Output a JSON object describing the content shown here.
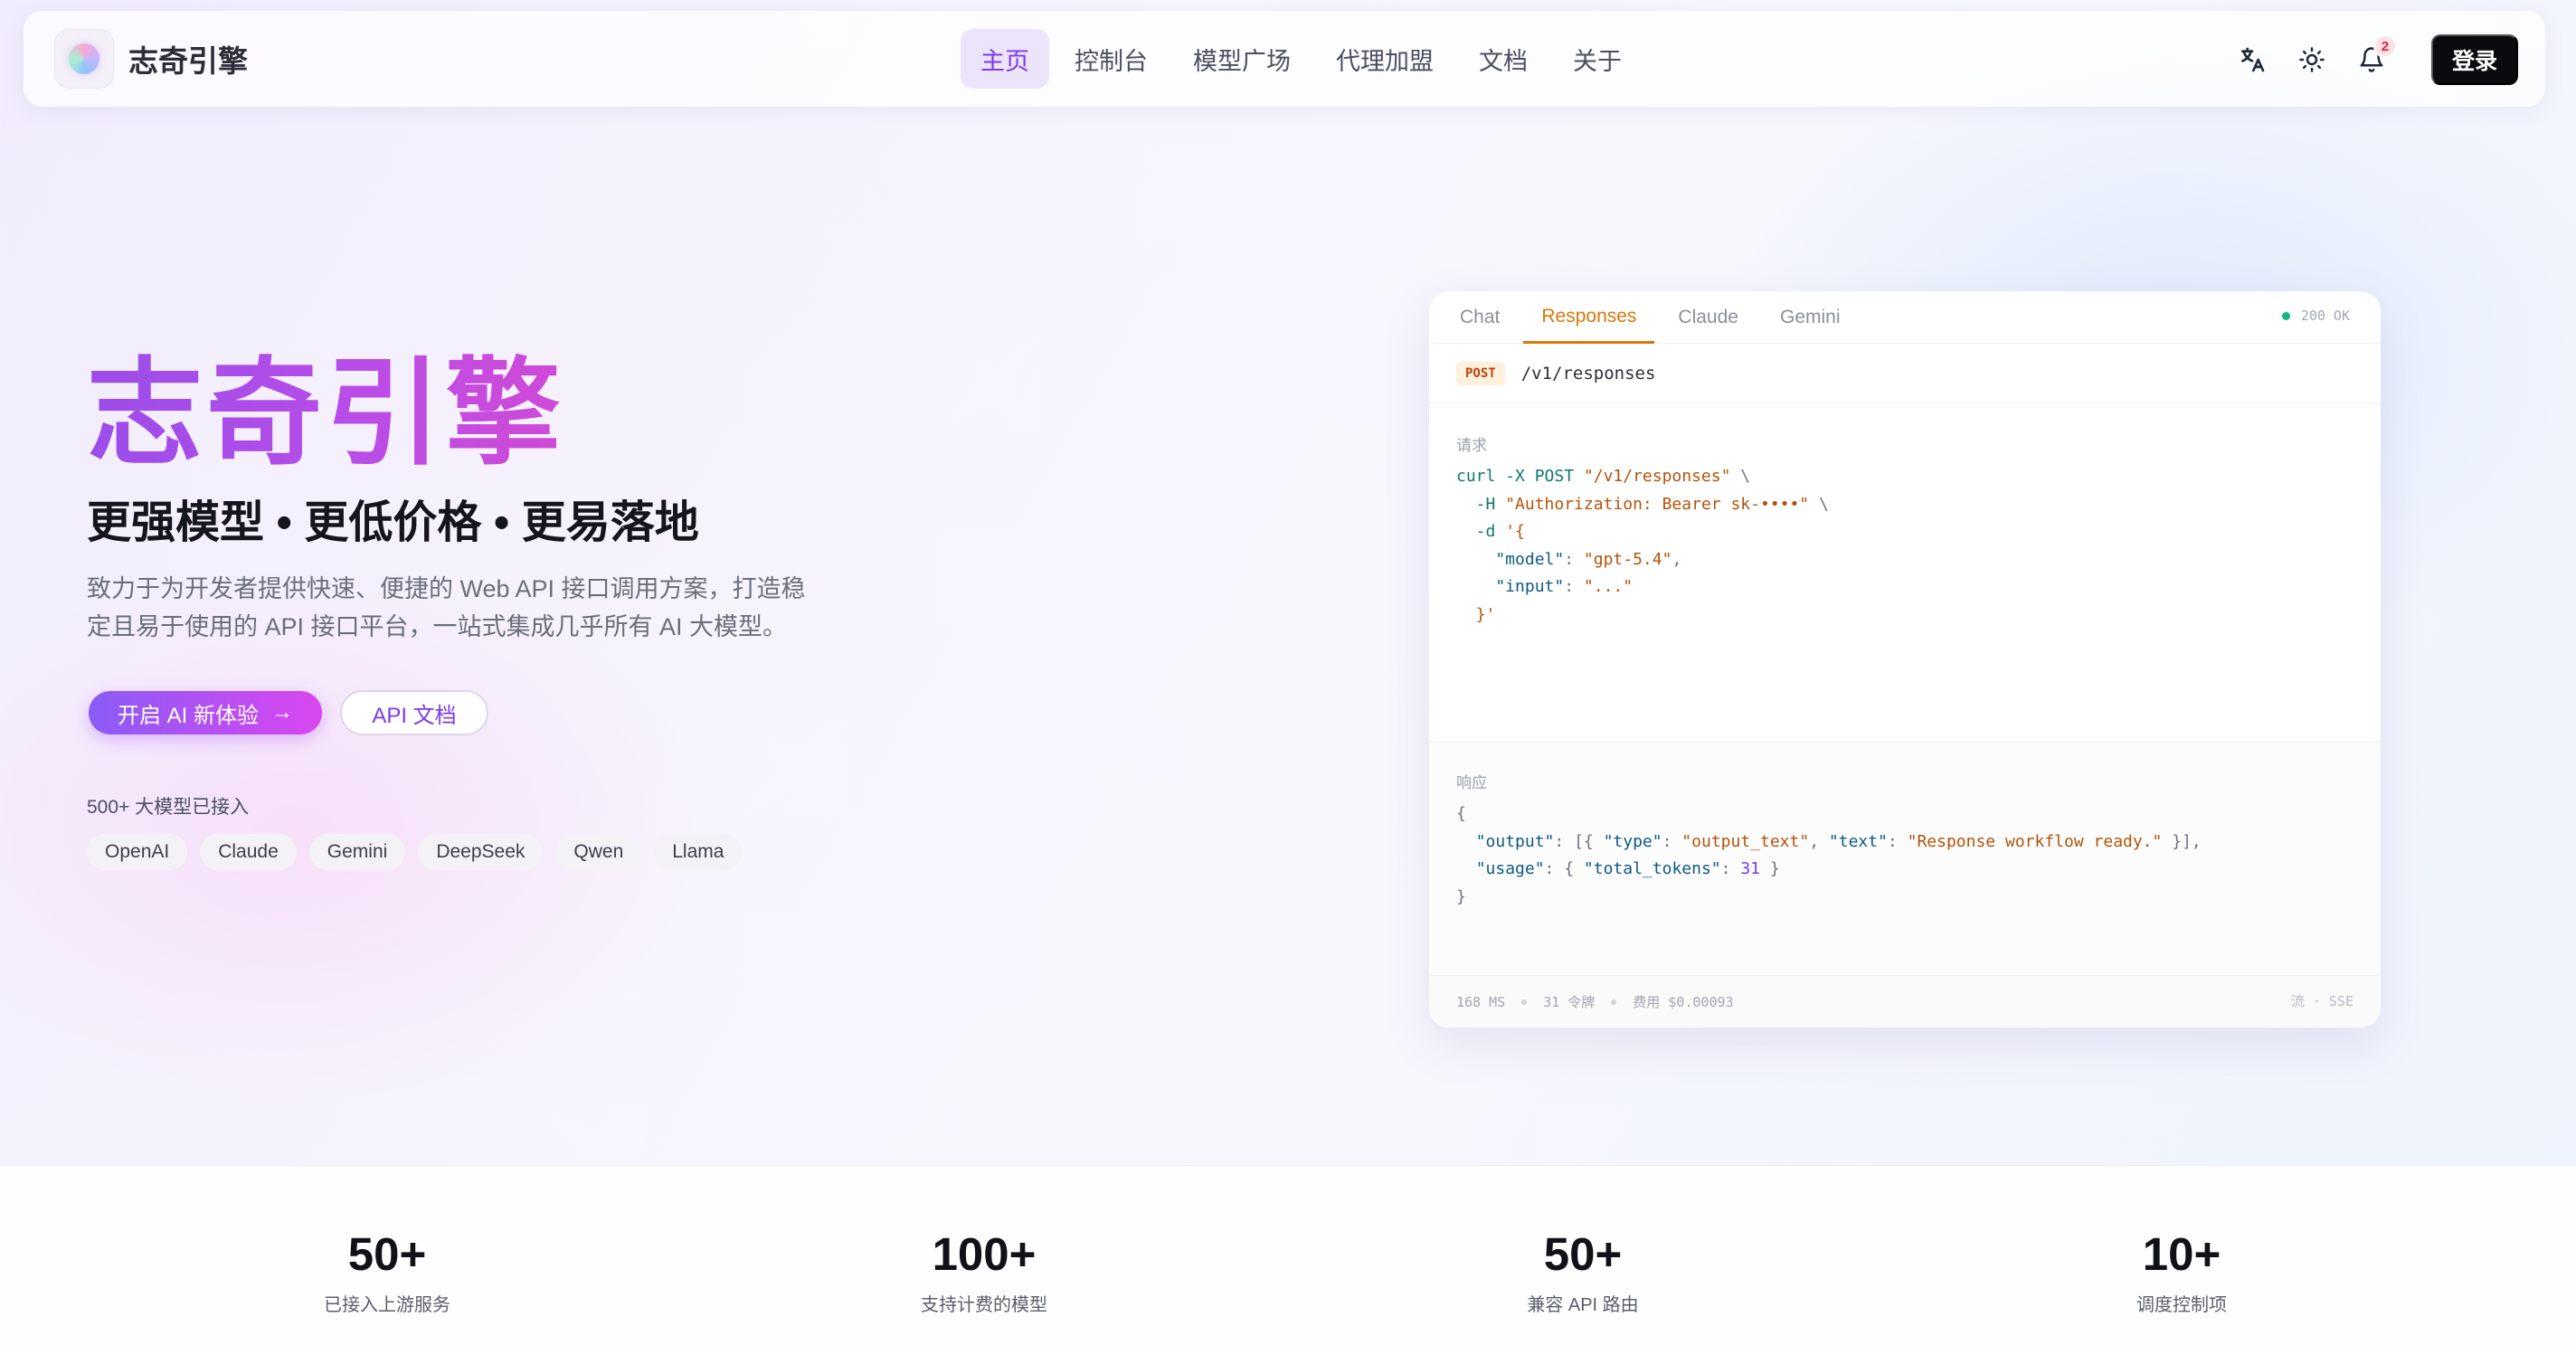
{
  "header": {
    "brand_name": "志奇引擎",
    "nav": [
      {
        "label": "主页",
        "active": true
      },
      {
        "label": "控制台"
      },
      {
        "label": "模型广场"
      },
      {
        "label": "代理加盟"
      },
      {
        "label": "文档"
      },
      {
        "label": "关于"
      }
    ],
    "icons": {
      "language": "translate-icon",
      "theme": "sun-icon",
      "notifications": "bell-icon"
    },
    "notification_count": "2",
    "login_label": "登录"
  },
  "hero": {
    "title": "志奇引擎",
    "subtitle": "更强模型 • 更低价格 • 更易落地",
    "description": "致力于为开发者提供快速、便捷的 Web API 接口调用方案，打造稳定且易于使用的 API 接口平台，一站式集成几乎所有 AI 大模型。",
    "primary_cta": "开启 AI 新体验",
    "secondary_cta": "API 文档",
    "models_count": "500+ 大模型已接入",
    "models": [
      "OpenAI",
      "Claude",
      "Gemini",
      "DeepSeek",
      "Qwen",
      "Llama"
    ]
  },
  "code_card": {
    "tabs": [
      {
        "label": "Chat"
      },
      {
        "label": "Responses",
        "active": true
      },
      {
        "label": "Claude"
      },
      {
        "label": "Gemini"
      }
    ],
    "status": "200 OK",
    "method": "POST",
    "endpoint": "/v1/responses",
    "request_label": "请求",
    "response_label": "响应",
    "request_lines": [
      {
        "cmd": "curl -X POST",
        "str": "\"/v1/responses\"",
        "tail": " \\"
      },
      {
        "cmd": "  -H",
        "str": "\"Authorization: Bearer sk-••••\"",
        "tail": " \\"
      },
      {
        "cmd": "  -d",
        "str": "'{",
        "tail": ""
      },
      {
        "key": "    \"model\"",
        "str": "\"gpt-5.4\"",
        "tail": ","
      },
      {
        "key": "    \"input\"",
        "str": "\"...\"",
        "tail": ""
      },
      {
        "str": "  }'"
      }
    ],
    "response_json": {
      "type_value": "output_text",
      "text_value": "Response workflow ready.",
      "total_tokens": "31"
    },
    "footer": {
      "latency": "168 MS",
      "tokens": "31 令牌",
      "cost": "费用 $0.00093",
      "stream": "流 · SSE"
    }
  },
  "stats": [
    {
      "value": "50+",
      "label": "已接入上游服务"
    },
    {
      "value": "100+",
      "label": "支持计费的模型"
    },
    {
      "value": "50+",
      "label": "兼容 API 路由"
    },
    {
      "value": "10+",
      "label": "调度控制项"
    }
  ],
  "colors": {
    "accent": "#7c3aed",
    "gradient_start": "#8b5cf6",
    "gradient_end": "#d946ef",
    "tab_active": "#d97706",
    "status_ok": "#10b981"
  }
}
